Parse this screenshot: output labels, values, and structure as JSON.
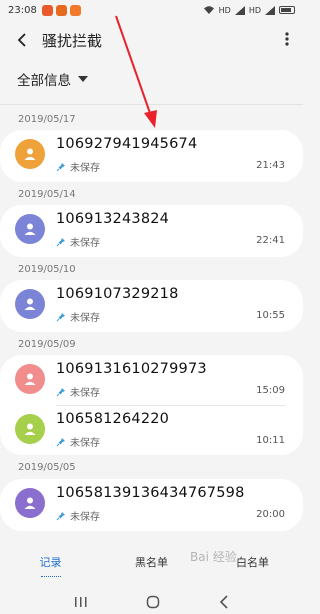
{
  "status_bar": {
    "time": "23:08",
    "app_colors": [
      "#e85a2a",
      "#e66a1d",
      "#f0792a"
    ],
    "signal_text": "HD",
    "battery_label": ""
  },
  "app_bar": {
    "title": "骚扰拦截"
  },
  "filter": {
    "label": "全部信息"
  },
  "groups": [
    {
      "date": "2019/05/17",
      "items": [
        {
          "number": "106927941945674",
          "status": "未保存",
          "time": "21:43",
          "avatar_color": "#f0a23a"
        }
      ]
    },
    {
      "date": "2019/05/14",
      "items": [
        {
          "number": "106913243824",
          "status": "未保存",
          "time": "22:41",
          "avatar_color": "#7b84d6"
        }
      ]
    },
    {
      "date": "2019/05/10",
      "items": [
        {
          "number": "1069107329218",
          "status": "未保存",
          "time": "10:55",
          "avatar_color": "#7b84d6"
        }
      ]
    },
    {
      "date": "2019/05/09",
      "items": [
        {
          "number": "1069131610279973",
          "status": "未保存",
          "time": "15:09",
          "avatar_color": "#f28d8d"
        },
        {
          "number": "106581264220",
          "status": "未保存",
          "time": "10:11",
          "avatar_color": "#a6cf4b"
        }
      ]
    },
    {
      "date": "2019/05/05",
      "items": [
        {
          "number": "10658139136434767598",
          "status": "未保存",
          "time": "20:00",
          "avatar_color": "#8b6fcf"
        }
      ]
    }
  ],
  "tabs": [
    "记录",
    "黑名单",
    "白名单"
  ],
  "active_tab": 0,
  "watermark": "Bai 经验",
  "accent_color": "#1f6fd1",
  "annotation_arrow_color": "#e8212a"
}
